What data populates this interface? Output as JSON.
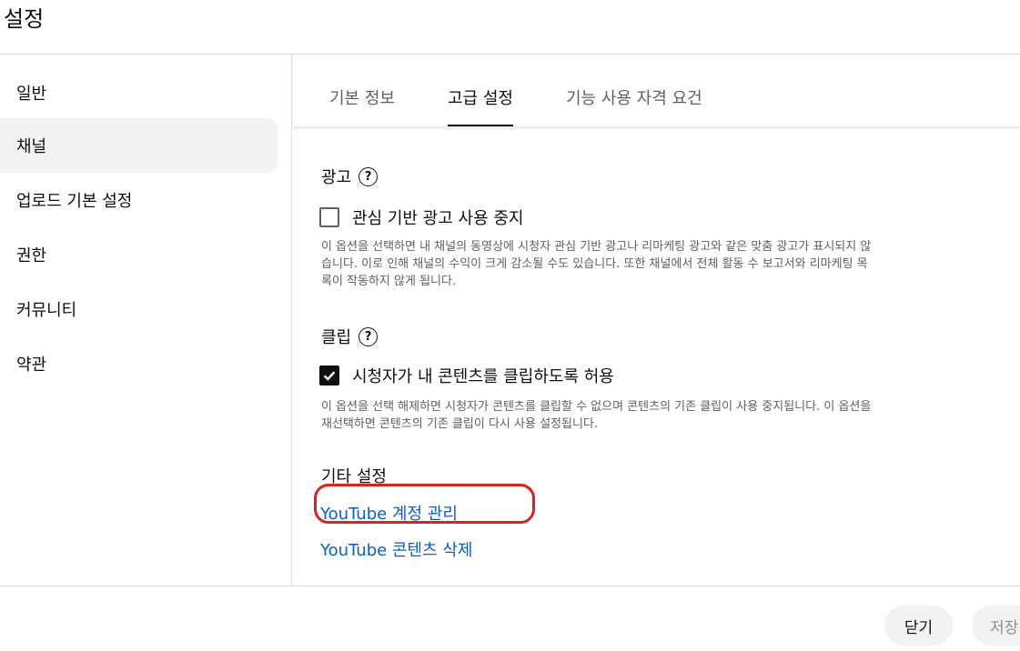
{
  "header": {
    "title": "설정"
  },
  "sidebar": {
    "items": [
      {
        "label": "일반"
      },
      {
        "label": "채널",
        "active": true
      },
      {
        "label": "업로드 기본 설정"
      },
      {
        "label": "권한"
      },
      {
        "label": "커뮤니티"
      },
      {
        "label": "약관"
      }
    ]
  },
  "tabs": [
    {
      "label": "기본 정보"
    },
    {
      "label": "고급 설정",
      "active": true
    },
    {
      "label": "기능 사용 자격 요건"
    }
  ],
  "ads": {
    "heading": "광고",
    "help_icon": "?",
    "checkbox_label": "관심 기반 광고 사용 중지",
    "checked": false,
    "description_lines": [
      "이 옵션을 선택하면 내 채널의 동영상에 시청자 관심 기반 광고나 리마케팅 광고와 같은 맞춤 광고가 표시되지 않",
      "습니다. 이로 인해 채널의 수익이 크게 감소될 수도 있습니다. 또한 채널에서 전체 활동 수 보고서와 리마케팅 목",
      "록이 작동하지 않게 됩니다."
    ]
  },
  "clips": {
    "heading": "클립",
    "help_icon": "?",
    "checkbox_label": "시청자가 내 콘텐츠를 클립하도록 허용",
    "checked": true,
    "description_lines": [
      "이 옵션을 선택 해제하면 시청자가 콘텐츠를 클립할 수 없으며 콘텐츠의 기존 클립이 사용 중지됩니다. 이 옵션을",
      "재선택하면 콘텐츠의 기존 클립이 다시 사용 설정됩니다."
    ]
  },
  "other": {
    "heading": "기타 설정",
    "links": [
      {
        "label": "YouTube 계정 관리"
      },
      {
        "label": "YouTube 콘텐츠 삭제"
      }
    ]
  },
  "footer": {
    "close_label": "닫기",
    "save_label": "저장"
  },
  "colors": {
    "link": "#065fd4",
    "highlight": "#e0201e",
    "active_bg": "#f2f2f2"
  }
}
